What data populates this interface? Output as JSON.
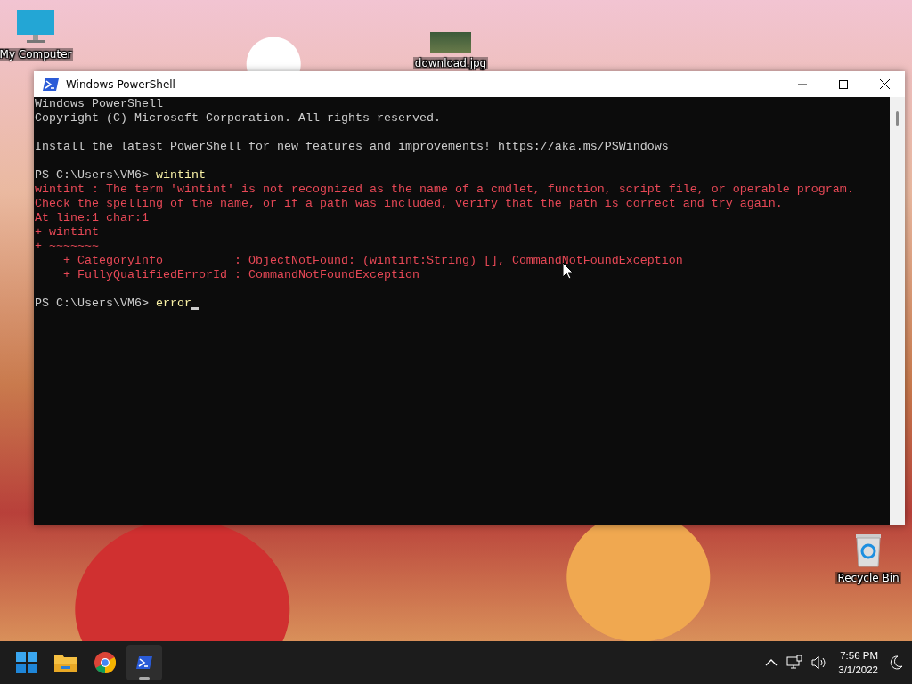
{
  "desktop_icons": [
    {
      "label": "My Computer",
      "kind": "computer"
    },
    {
      "label": "download.jpg",
      "kind": "image"
    },
    {
      "label": "Recycle Bin",
      "kind": "bin"
    }
  ],
  "window": {
    "title": "Windows PowerShell",
    "active": true
  },
  "console": {
    "lines": [
      {
        "kind": "output",
        "text": "Windows PowerShell"
      },
      {
        "kind": "output",
        "text": "Copyright (C) Microsoft Corporation. All rights reserved."
      },
      {
        "kind": "blank"
      },
      {
        "kind": "output",
        "text": "Install the latest PowerShell for new features and improvements! https://aka.ms/PSWindows"
      },
      {
        "kind": "blank"
      },
      {
        "kind": "prompt",
        "prompt": "PS C:\\Users\\VM6>",
        "command": "wintint",
        "cursor": false
      },
      {
        "kind": "error",
        "text": "wintint : The term 'wintint' is not recognized as the name of a cmdlet, function, script file, or operable program."
      },
      {
        "kind": "error",
        "text": "Check the spelling of the name, or if a path was included, verify that the path is correct and try again."
      },
      {
        "kind": "error",
        "text": "At line:1 char:1"
      },
      {
        "kind": "error",
        "text": "+ wintint"
      },
      {
        "kind": "error",
        "text": "+ ~~~~~~~"
      },
      {
        "kind": "error",
        "text": "    + CategoryInfo          : ObjectNotFound: (wintint:String) [], CommandNotFoundException"
      },
      {
        "kind": "error",
        "text": "    + FullyQualifiedErrorId : CommandNotFoundException"
      },
      {
        "kind": "blank"
      },
      {
        "kind": "prompt",
        "prompt": "PS C:\\Users\\VM6>",
        "command": "error",
        "cursor": true
      }
    ]
  },
  "taskbar": {
    "apps": [
      {
        "kind": "start",
        "selected": false
      },
      {
        "kind": "explorer",
        "selected": false
      },
      {
        "kind": "chrome",
        "selected": false
      },
      {
        "kind": "powershell",
        "selected": true
      }
    ],
    "time": "7:56 PM",
    "date": "3/1/2022"
  }
}
